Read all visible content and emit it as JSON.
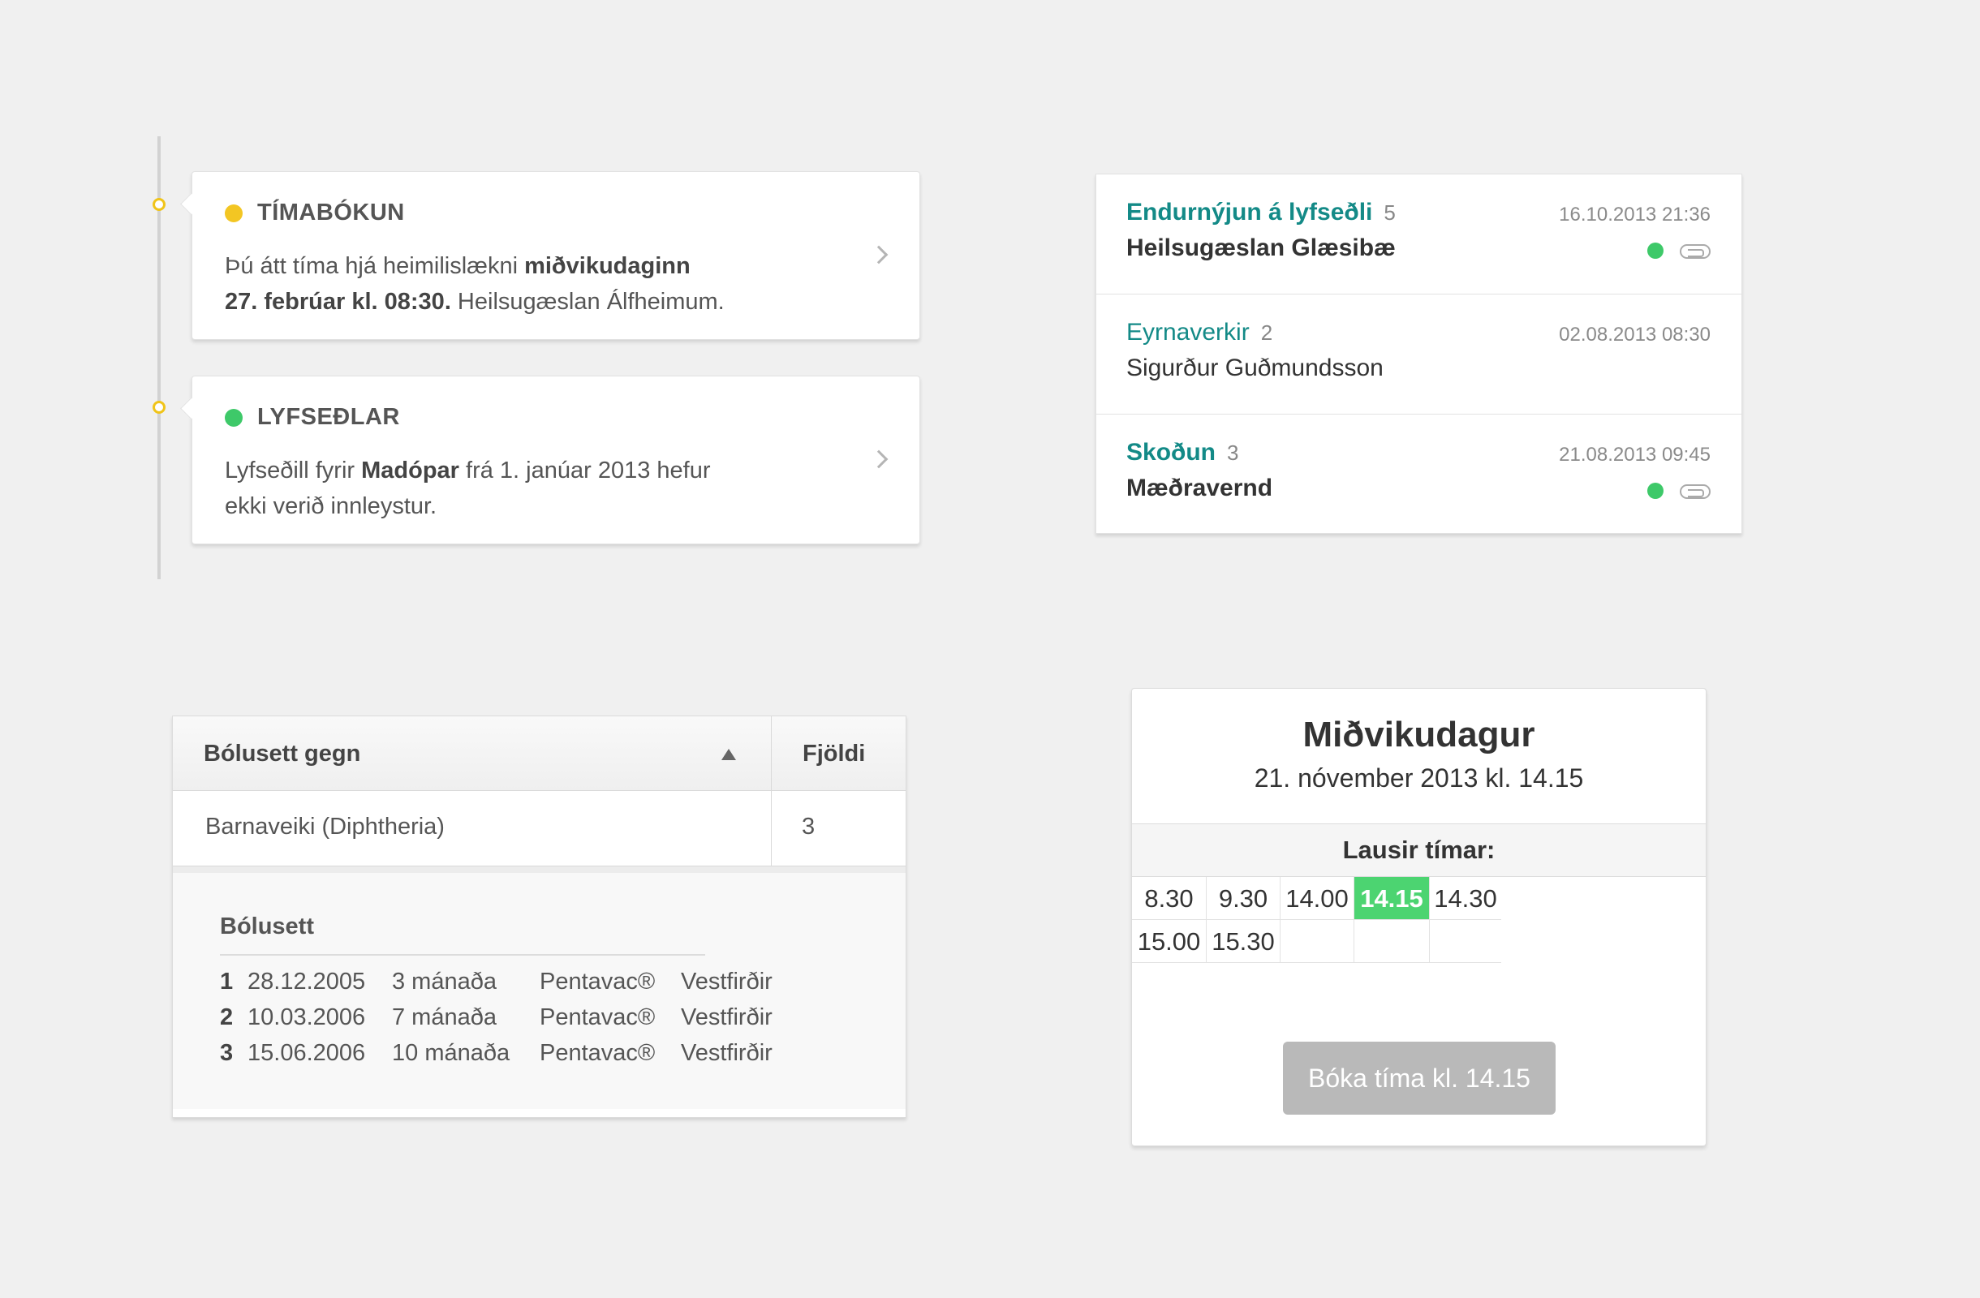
{
  "timeline": {
    "cards": [
      {
        "title": "TÍMABÓKUN",
        "status_color": "#f3c623",
        "text_pre": "Þú átt tíma hjá heimilislækni ",
        "text_bold1": "miðvikudaginn",
        "text_bold2": "27. febrúar kl. 08:30.",
        "text_post": " Heilsugæslan Álfheimum.",
        "icon": "chevron-right-icon"
      },
      {
        "title": "LYFSEÐLAR",
        "status_color": "#3ec969",
        "text_pre": "Lyfseðill fyrir ",
        "text_bold1": "Madópar",
        "text_mid": " frá 1. janúar 2013 hefur",
        "text_line2": "ekki verið innleystur.",
        "icon": "chevron-right-icon"
      }
    ]
  },
  "messages": [
    {
      "subject": "Endurnýjun á lyfseðli",
      "count": "5",
      "from": "Heilsugæslan Glæsibæ",
      "date": "16.10.2013 21:36",
      "unread": true,
      "attachment": true
    },
    {
      "subject": "Eyrnaverkir",
      "count": "2",
      "from": "Sigurður Guðmundsson",
      "date": "02.08.2013 08:30",
      "unread": false,
      "attachment": false
    },
    {
      "subject": "Skoðun",
      "count": "3",
      "from": "Mæðravernd",
      "date": "21.08.2013 09:45",
      "unread": true,
      "attachment": true
    }
  ],
  "vaccinations": {
    "col_vaccinated_against": "Bólusett gegn",
    "col_count": "Fjöldi",
    "sort_icon": "sort-ascending-icon",
    "row": {
      "name": "Barnaveiki (Diphtheria)",
      "count": "3"
    },
    "detail_title": "Bólusett",
    "doses": [
      {
        "num": "1",
        "date": "28.12.2005",
        "age": "3 mánaða",
        "vaccine": "Pentavac®",
        "region": "Vestfirðir"
      },
      {
        "num": "2",
        "date": "10.03.2006",
        "age": "7 mánaða",
        "vaccine": "Pentavac®",
        "region": "Vestfirðir"
      },
      {
        "num": "3",
        "date": "15.06.2006",
        "age": "10 mánaða",
        "vaccine": "Pentavac®",
        "region": "Vestfirðir"
      }
    ]
  },
  "booking": {
    "day": "Miðvikudagur",
    "date": "21. nóvember 2013 kl. 14.15",
    "slots_label": "Lausir tímar:",
    "slots": [
      "8.30",
      "9.30",
      "14.00",
      "14.15",
      "14.30",
      "15.00",
      "15.30",
      "",
      "",
      ""
    ],
    "selected_slot": "14.15",
    "accent": "#4cd471",
    "book_button": "Bóka tíma kl. 14.15"
  }
}
